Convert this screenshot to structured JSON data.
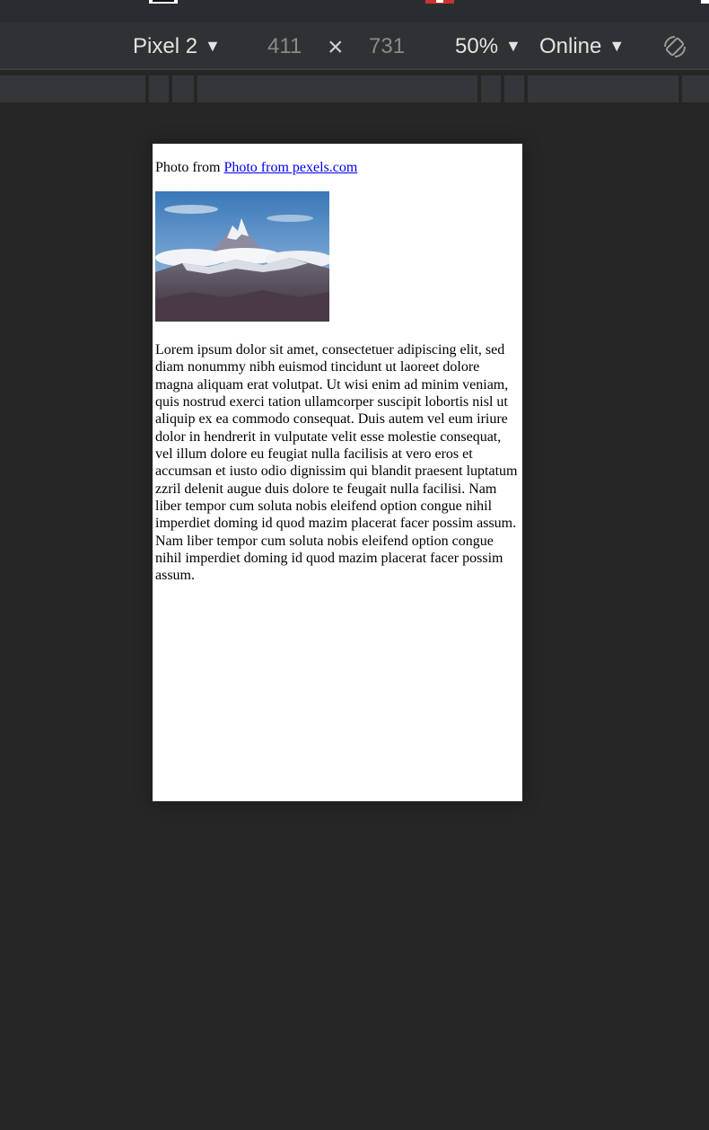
{
  "toolbar": {
    "device": "Pixel 2",
    "width": "411",
    "height": "731",
    "times": "×",
    "zoom": "50%",
    "network": "Online",
    "caret": "▼"
  },
  "page": {
    "credit_prefix": "Photo from",
    "credit_link": "Photo from pexels.com",
    "image_alt": "snow-capped mountain peak under blue sky",
    "body_text": "Lorem ipsum dolor sit amet, consectetuer adipiscing elit, sed diam nonummy nibh euismod tincidunt ut laoreet dolore magna aliquam erat volutpat. Ut wisi enim ad minim veniam, quis nostrud exerci tation ullamcorper suscipit lobortis nisl ut aliquip ex ea commodo consequat. Duis autem vel eum iriure dolor in hendrerit in vulputate velit esse molestie consequat, vel illum dolore eu feugiat nulla facilisis at vero eros et accumsan et iusto odio dignissim qui blandit praesent luptatum zzril delenit augue duis dolore te feugait nulla facilisi. Nam liber tempor cum soluta nobis eleifend option congue nihil imperdiet doming id quod mazim placerat facer possim assum. Nam liber tempor cum soluta nobis eleifend option congue nihil imperdiet doming id quod mazim placerat facer possim assum."
  },
  "icons": {
    "rotate": "rotate-icon"
  },
  "colors": {
    "toolbar_bg": "#2f3134",
    "canvas_bg": "#262626",
    "link": "#0000ee"
  }
}
